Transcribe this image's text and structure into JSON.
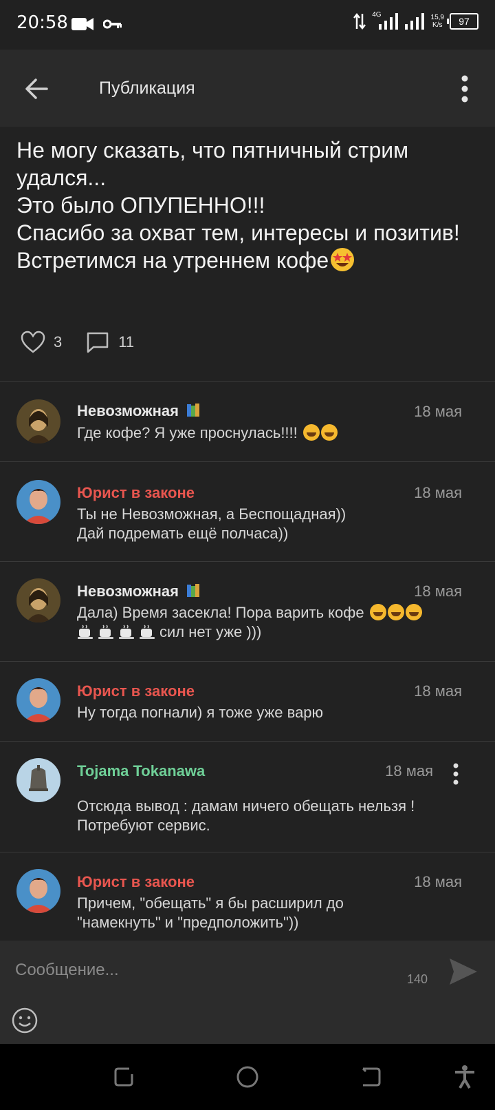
{
  "status": {
    "time": "20:58",
    "network": "4G",
    "speed_value": "15,9",
    "speed_unit": "K/s",
    "battery": "97"
  },
  "appbar": {
    "title": "Публикация"
  },
  "post": {
    "text": "Не могу сказать, что пятничный стрим удался...\nЭто было ОПУПЕННО!!!\nСпасибо за охват тем, интересы и позитив!\nВстретимся на утреннем кофе",
    "likes": "3",
    "comments": "11"
  },
  "comments": [
    {
      "author": "Невозможная",
      "author_color": "#ffffff",
      "date": "18 мая",
      "text": "Где кофе? Я уже проснулась!!!!"
    },
    {
      "author": "Юрист в законе",
      "author_color": "#e8564f",
      "date": "18 мая",
      "text": "Ты не Невозможная, а Беспощадная))\nДай подремать ещё полчаса))"
    },
    {
      "author": "Невозможная",
      "author_color": "#ffffff",
      "date": "18 мая",
      "text_a": "Дала) Время засекла! Пора варить кофе",
      "text_b": "сил нет уже )))"
    },
    {
      "author": "Юрист в законе",
      "author_color": "#e8564f",
      "date": "18 мая",
      "text": "Ну тогда погнали) я тоже уже варю"
    },
    {
      "author": "Tojama Tokanawa",
      "author_color": "#6fcf97",
      "date": "18 мая",
      "text": "Отсюда вывод : дамам ничего обещать нельзя !\nПотребуют сервис."
    },
    {
      "author": "Юрист в законе",
      "author_color": "#e8564f",
      "date": "18 мая",
      "text": "Причем, \"обещать\" я бы расширил до\n\"намекнуть\" и \"предположить\"))"
    }
  ],
  "composer": {
    "placeholder": "Сообщение...",
    "counter": "140"
  }
}
